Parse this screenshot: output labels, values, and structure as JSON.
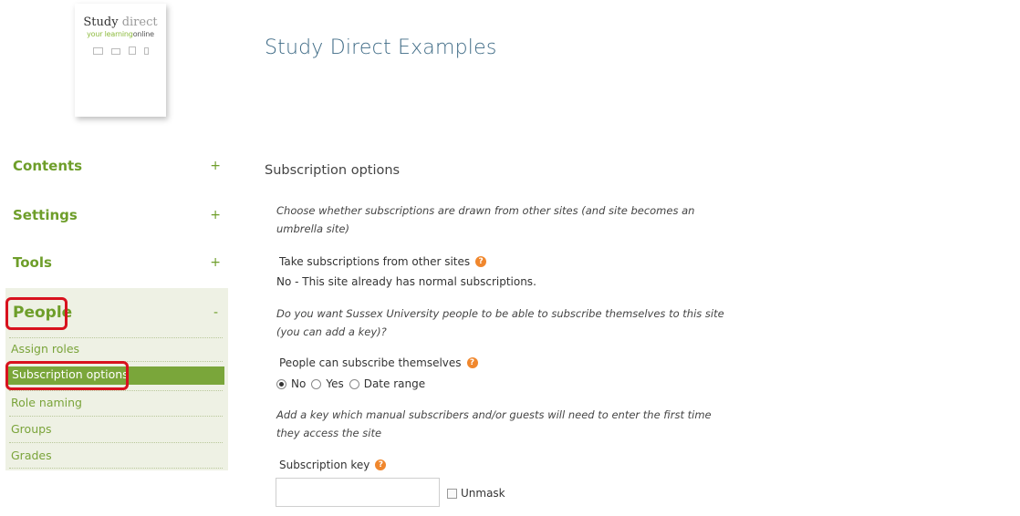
{
  "logo": {
    "brand_dark": "Study",
    "brand_light": "direct",
    "tagline_green": "your learning",
    "tagline_dark": "online"
  },
  "site_title": "Study Direct Examples",
  "sidebar": {
    "sections": [
      {
        "label": "Contents",
        "toggle": "+"
      },
      {
        "label": "Settings",
        "toggle": "+"
      },
      {
        "label": "Tools",
        "toggle": "+"
      },
      {
        "label": "People",
        "toggle": "-"
      }
    ],
    "people_items": [
      {
        "label": "Assign roles"
      },
      {
        "label": "Subscription options"
      },
      {
        "label": "Role naming"
      },
      {
        "label": "Groups"
      },
      {
        "label": "Grades"
      }
    ],
    "active_item": "Subscription options"
  },
  "main": {
    "heading": "Subscription options",
    "intro1": "Choose whether subscriptions are drawn from other sites (and site becomes an umbrella site)",
    "take_label": "Take subscriptions from other sites",
    "take_value": "No - This site already has normal subscriptions.",
    "intro2": "Do you want Sussex University people to be able to subscribe themselves to this site (you can add a key)?",
    "self_label": "People can subscribe themselves",
    "radio_options": [
      {
        "label": "No",
        "checked": true
      },
      {
        "label": "Yes",
        "checked": false
      },
      {
        "label": "Date range",
        "checked": false
      }
    ],
    "intro3": "Add a key which manual subscribers and/or guests will need to enter the first time they access the site",
    "key_label": "Subscription key",
    "key_value": "",
    "unmask_label": "Unmask"
  },
  "colors": {
    "nav_green": "#6e9e2a",
    "active_bg": "#7aa63a",
    "highlight_red": "#d8121e",
    "title_blue": "#3f6b86",
    "help_orange": "#f0872d"
  }
}
